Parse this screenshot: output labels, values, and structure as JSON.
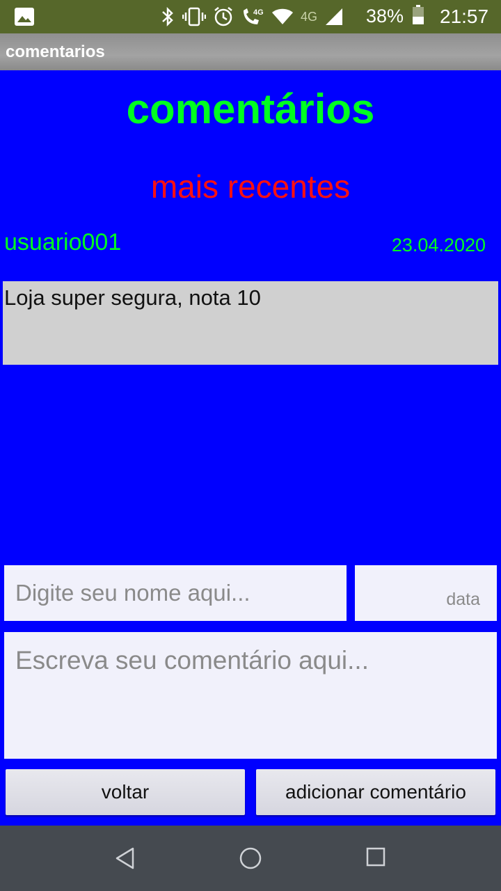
{
  "status_bar": {
    "battery_percent": "38%",
    "time": "21:57",
    "network_label": "4G",
    "icons": [
      "image-icon",
      "bluetooth-icon",
      "vibrate-icon",
      "alarm-icon",
      "volte-call-icon",
      "wifi-icon",
      "signal-icon",
      "battery-icon"
    ]
  },
  "app_bar": {
    "title": "comentarios"
  },
  "header": {
    "title": "comentários",
    "subtitle": "mais recentes"
  },
  "comments": [
    {
      "user": "usuario001",
      "date": "23.04.2020",
      "text": "Loja super segura, nota 10"
    }
  ],
  "form": {
    "name_placeholder": "Digite seu nome aqui...",
    "date_placeholder": "data",
    "comment_placeholder": "Escreva seu comentário aqui..."
  },
  "buttons": {
    "back_label": "voltar",
    "add_label": "adicionar comentário"
  },
  "colors": {
    "background": "#0000ff",
    "title": "#00ff20",
    "subtitle": "#ff1010",
    "status_bar": "#56672a"
  }
}
